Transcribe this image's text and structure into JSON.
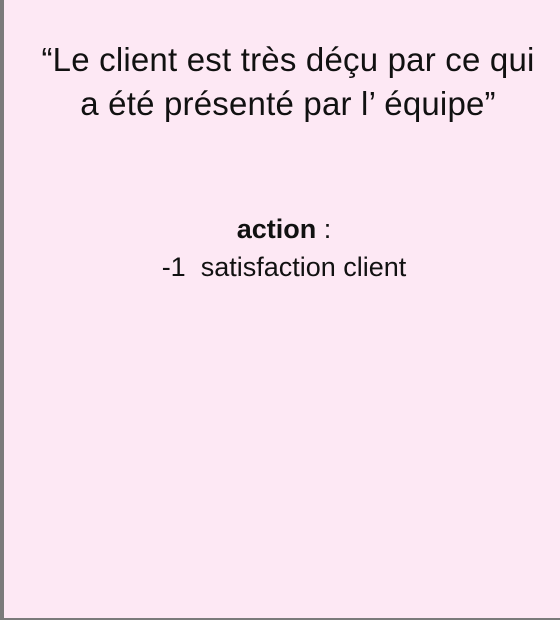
{
  "card": {
    "background": "#fde8f4",
    "quote": "“Le client est très déçu par ce qui a été présenté par l’ équipe”",
    "action_label": "action",
    "action_separator": " :",
    "effect": "-1  satisfaction client"
  }
}
